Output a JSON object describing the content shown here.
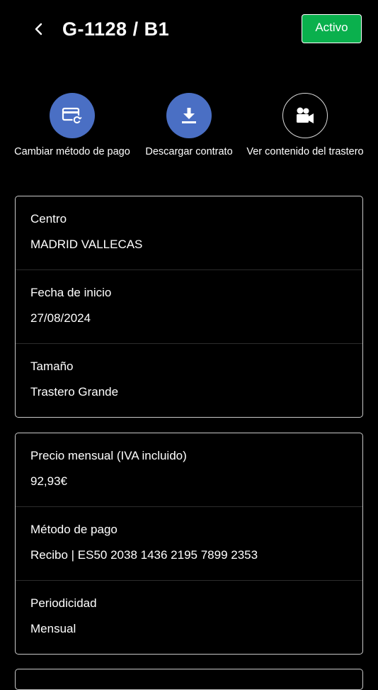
{
  "header": {
    "title": "G-1128 / B1",
    "status": "Activo",
    "back_icon": "chevron-left-icon"
  },
  "actions": [
    {
      "label": "Cambiar método de pago",
      "icon": "payment-card-refresh-icon",
      "style": "filled"
    },
    {
      "label": "Descargar contrato",
      "icon": "download-icon",
      "style": "filled"
    },
    {
      "label": "Ver contenido del trastero",
      "icon": "video-camera-icon",
      "style": "outline"
    }
  ],
  "details_card": [
    {
      "label": "Centro",
      "value": "MADRID VALLECAS"
    },
    {
      "label": "Fecha de inicio",
      "value": "27/08/2024"
    },
    {
      "label": "Tamaño",
      "value": "Trastero Grande"
    }
  ],
  "billing_card": [
    {
      "label": "Precio mensual (IVA incluido)",
      "value": "92,93€"
    },
    {
      "label": "Método de pago",
      "value": "Recibo | ES50 2038 1436 2195 7899 2353"
    },
    {
      "label": "Periodicidad",
      "value": "Mensual"
    }
  ],
  "colors": {
    "background": "#000000",
    "status_green": "#0ab04d",
    "action_blue": "#4a6fc4",
    "card_border": "#c9c9c9"
  }
}
